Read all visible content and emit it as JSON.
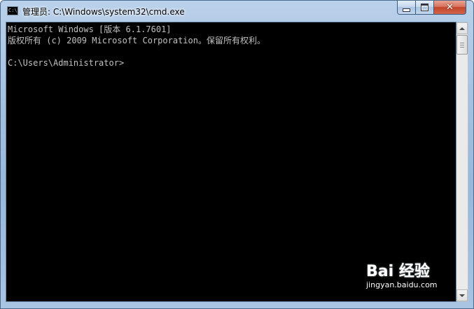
{
  "window": {
    "title": "管理员: C:\\Windows\\system32\\cmd.exe",
    "icon_label": "C:\\"
  },
  "controls": {
    "minimize": "minimize-icon",
    "maximize": "maximize-icon",
    "close": "close-icon"
  },
  "console": {
    "lines": [
      "Microsoft Windows [版本 6.1.7601]",
      "版权所有 (c) 2009 Microsoft Corporation。保留所有权利。",
      "",
      "C:\\Users\\Administrator>"
    ]
  },
  "watermark": {
    "logo_text": "Bai 经验",
    "url": "jingyan.baidu.com"
  },
  "colors": {
    "console_bg": "#000000",
    "console_text": "#c0c0c0",
    "close_button": "#c2452a"
  }
}
